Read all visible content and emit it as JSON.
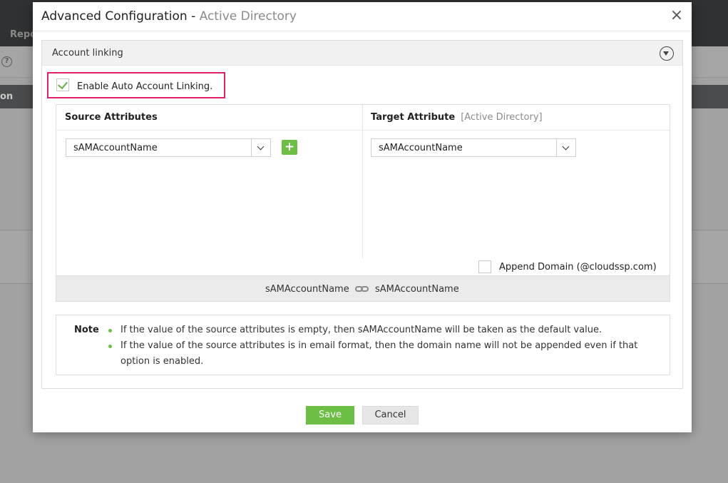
{
  "background": {
    "tab_label": "Repo",
    "header_label": "on",
    "help_icon": "?"
  },
  "dialog": {
    "title": "Advanced Configuration",
    "title_sep": " - ",
    "subtitle": "Active Directory",
    "close_glyph": "×"
  },
  "panel": {
    "title": "Account linking",
    "enable_label": "Enable Auto Account Linking.",
    "enable_checked": true
  },
  "mapping": {
    "source_header": "Source Attributes",
    "target_header": "Target Attribute",
    "target_header_tag": "[Active Directory]",
    "source_value": "sAMAccountName",
    "target_value": "sAMAccountName",
    "add_glyph": "+",
    "append_label": "Append Domain (@cloudssp.com)",
    "append_checked": false,
    "link_left": "sAMAccountName",
    "link_right": "sAMAccountName"
  },
  "note": {
    "label": "Note",
    "items": [
      "If the value of the source attributes is empty, then sAMAccountName will be taken as the default value.",
      "If the value of the source attributes is in email format, then the domain name will not be appended even if that option is enabled."
    ]
  },
  "buttons": {
    "save": "Save",
    "cancel": "Cancel"
  },
  "colors": {
    "accent_green": "#6cbe45",
    "highlight_pink": "#e0206a"
  }
}
